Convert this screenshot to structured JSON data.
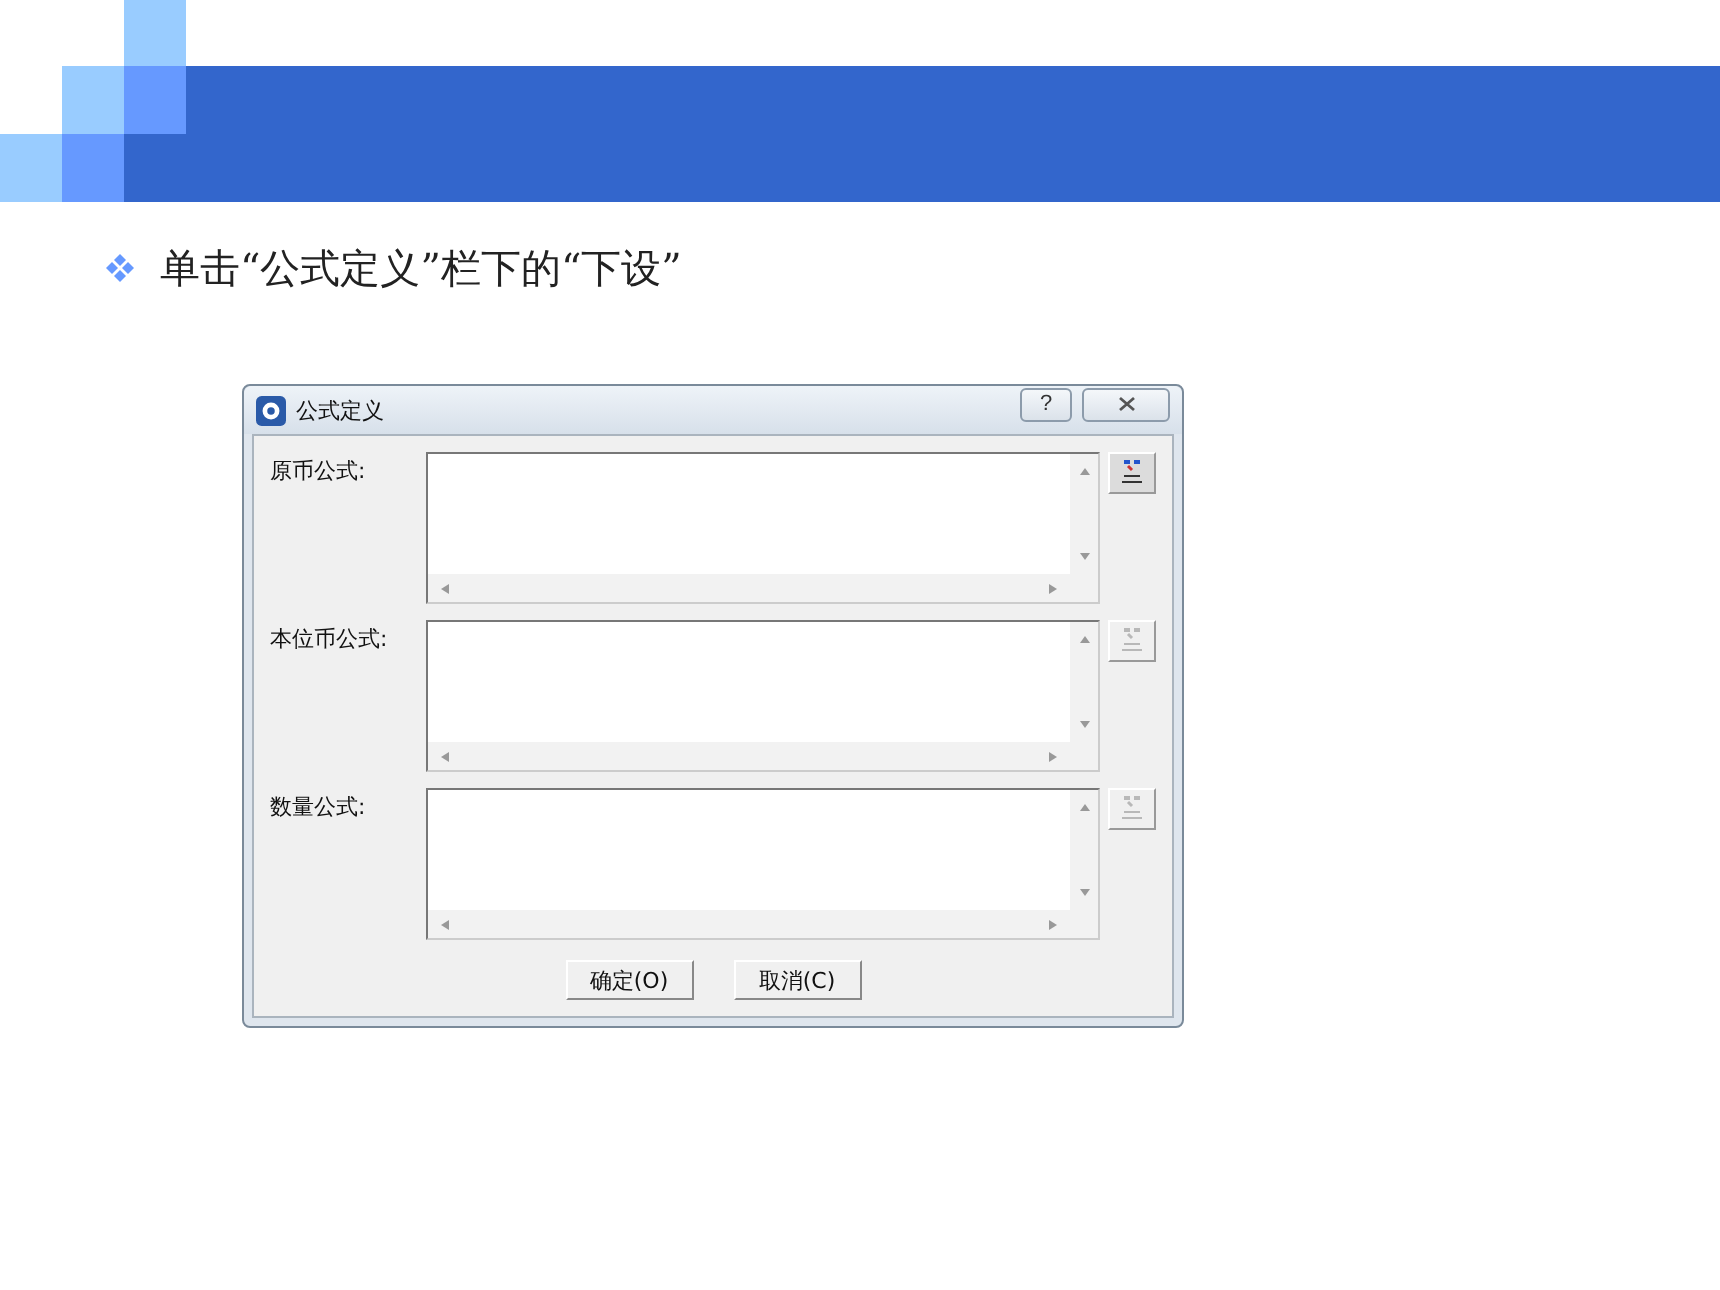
{
  "slide": {
    "bullet_text": "单击“公式定义”栏下的“下设”"
  },
  "dialog": {
    "title": "公式定义",
    "help_label": "?",
    "fields": [
      {
        "label": "原币公式:",
        "picker_disabled": false
      },
      {
        "label": "本位币公式:",
        "picker_disabled": true
      },
      {
        "label": "数量公式:",
        "picker_disabled": true
      }
    ],
    "buttons": [
      "确定(O)",
      "取消(C)"
    ]
  }
}
